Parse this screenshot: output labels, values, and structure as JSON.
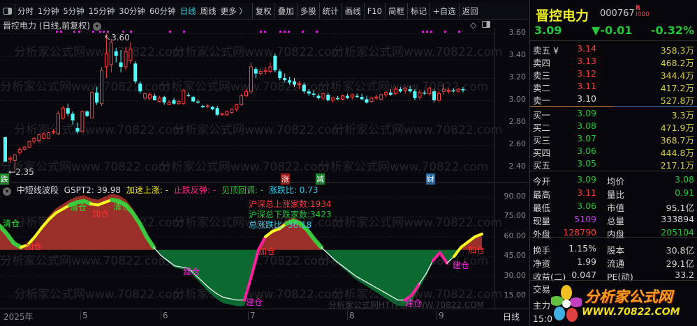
{
  "toolbar": {
    "items": [
      "分时",
      "1分钟",
      "5分钟",
      "15分钟",
      "30分钟",
      "60分钟",
      "日线",
      "周线",
      "更多 〉"
    ],
    "active": "日线",
    "right_items": [
      "复权",
      "叠加",
      "多股",
      "统计",
      "画线",
      "F10",
      "简框",
      "标记",
      "+自选",
      "返回"
    ]
  },
  "chart": {
    "title": "晋控电力 (日线,前复权)",
    "high_label": "3.60",
    "low_label": "2.35",
    "price_ticks": [
      "3.60",
      "3.40",
      "3.20",
      "3.00",
      "2.80",
      "2.60",
      "2.40"
    ],
    "signals": [
      {
        "text": "跌",
        "color": "#1a8a2a"
      },
      {
        "text": "涨",
        "color": "#a01818"
      },
      {
        "text": "减",
        "color": "#1a8a2a"
      },
      {
        "text": "财",
        "color": "#2a6aa0"
      }
    ]
  },
  "watermark": "分析家公式网www.70822.com",
  "watermark2": "分析家公式网HTTP://WWW.70822.COM",
  "indicator": {
    "name": "中短线波段",
    "gspt": "GSPT2: 39.98",
    "accel": "加速上涨: -",
    "rebound": "止跌反弹: -",
    "top": "见顶回调: -",
    "ratio": "涨跌比: 0.73",
    "up_count": "沪深总上涨家数:1934",
    "down_count": "沪深总下跌家数:3423",
    "total_ratio": "总涨跌比: 36.18",
    "ticks": [
      "90.00",
      "75.00",
      "60.00",
      "45.00",
      "30.00",
      "15.00"
    ],
    "labels": {
      "clear": "清仓",
      "add": "加仓",
      "build": "建仓"
    }
  },
  "xaxis": {
    "labels": [
      "2025年",
      "5",
      "6",
      "7",
      "8",
      "9"
    ],
    "period": "日线"
  },
  "colors": {
    "up": "#ff4040",
    "down": "#54ffff",
    "clear": "#3cc83c",
    "accel": "#ffff20",
    "rebound": "#ff20a0",
    "fall": "#ffffff",
    "area_up": "#9a2e28",
    "area_down": "#0a6a30"
  },
  "chart_data": [
    {
      "type": "candlestick",
      "name": "price",
      "ylim": [
        2.35,
        3.65
      ],
      "ohlc": [
        [
          2.67,
          2.67,
          2.45,
          2.45
        ],
        [
          2.47,
          2.5,
          2.44,
          2.48
        ],
        [
          2.46,
          2.52,
          2.35,
          2.51
        ],
        [
          2.53,
          2.58,
          2.51,
          2.56
        ],
        [
          2.56,
          2.59,
          2.55,
          2.58
        ],
        [
          2.58,
          2.64,
          2.57,
          2.63
        ],
        [
          2.63,
          2.67,
          2.61,
          2.66
        ],
        [
          2.64,
          2.7,
          2.62,
          2.69
        ],
        [
          2.66,
          2.71,
          2.65,
          2.7
        ],
        [
          2.66,
          2.72,
          2.66,
          2.71
        ],
        [
          2.72,
          2.74,
          2.7,
          2.72
        ],
        [
          2.7,
          2.9,
          2.69,
          2.88
        ],
        [
          2.84,
          2.95,
          2.83,
          2.93
        ],
        [
          2.93,
          2.97,
          2.86,
          2.88
        ],
        [
          2.88,
          2.9,
          2.78,
          2.82
        ],
        [
          2.75,
          2.8,
          2.7,
          2.72
        ],
        [
          2.72,
          2.91,
          2.71,
          2.9
        ],
        [
          2.9,
          2.91,
          2.85,
          2.86
        ],
        [
          2.84,
          3.08,
          2.84,
          3.07
        ],
        [
          3.07,
          3.12,
          2.96,
          2.98
        ],
        [
          2.97,
          3.3,
          2.95,
          3.27
        ],
        [
          3.3,
          3.6,
          3.2,
          3.42
        ],
        [
          3.32,
          3.55,
          3.25,
          3.52
        ],
        [
          3.44,
          3.47,
          3.34,
          3.4
        ],
        [
          3.34,
          3.45,
          3.25,
          3.3
        ],
        [
          3.3,
          3.48,
          3.27,
          3.44
        ],
        [
          3.36,
          3.52,
          3.33,
          3.46
        ],
        [
          3.33,
          3.35,
          3.15,
          3.17
        ],
        [
          3.15,
          3.17,
          3.06,
          3.08
        ],
        [
          3.02,
          3.07,
          3.0,
          3.06
        ],
        [
          3.02,
          3.07,
          3.0,
          3.05
        ],
        [
          3.04,
          3.06,
          3.0,
          3.0
        ],
        [
          2.99,
          3.04,
          2.98,
          3.02
        ],
        [
          3.03,
          3.04,
          2.96,
          2.98
        ],
        [
          2.96,
          3.0,
          2.96,
          2.98
        ],
        [
          3.0,
          3.02,
          2.96,
          2.97
        ],
        [
          2.97,
          3.0,
          2.96,
          2.99
        ],
        [
          2.97,
          3.1,
          2.96,
          3.09
        ],
        [
          3.05,
          3.07,
          3.03,
          3.04
        ],
        [
          3.03,
          3.04,
          2.98,
          2.99
        ],
        [
          2.99,
          3.01,
          2.97,
          2.98
        ],
        [
          2.95,
          2.96,
          2.93,
          2.94
        ],
        [
          2.95,
          2.97,
          2.93,
          2.95
        ],
        [
          2.94,
          2.95,
          2.91,
          2.92
        ],
        [
          2.93,
          2.95,
          2.86,
          2.87
        ],
        [
          2.87,
          2.89,
          2.86,
          2.88
        ],
        [
          2.87,
          2.91,
          2.86,
          2.9
        ],
        [
          2.89,
          2.93,
          2.88,
          2.92
        ],
        [
          2.92,
          2.97,
          2.9,
          2.96
        ],
        [
          2.96,
          3.06,
          2.95,
          3.04
        ],
        [
          3.04,
          3.1,
          3.03,
          3.08
        ],
        [
          3.08,
          3.34,
          3.06,
          3.3
        ],
        [
          3.28,
          3.3,
          3.2,
          3.24
        ],
        [
          3.24,
          3.28,
          3.22,
          3.26
        ],
        [
          3.26,
          3.3,
          3.23,
          3.27
        ],
        [
          3.26,
          3.34,
          3.24,
          3.3
        ],
        [
          3.4,
          3.42,
          3.25,
          3.27
        ],
        [
          3.26,
          3.28,
          3.18,
          3.2
        ],
        [
          3.2,
          3.24,
          3.16,
          3.18
        ],
        [
          3.18,
          3.21,
          3.14,
          3.16
        ],
        [
          3.17,
          3.2,
          3.12,
          3.14
        ],
        [
          3.14,
          3.17,
          3.1,
          3.15
        ],
        [
          3.14,
          3.16,
          3.06,
          3.08
        ],
        [
          3.08,
          3.1,
          3.04,
          3.06
        ],
        [
          3.06,
          3.09,
          3.03,
          3.05
        ],
        [
          3.04,
          3.06,
          3.01,
          3.02
        ],
        [
          3.02,
          3.07,
          3.0,
          3.06
        ],
        [
          3.05,
          3.07,
          2.99,
          3.0
        ],
        [
          3.0,
          3.03,
          2.98,
          3.02
        ],
        [
          3.02,
          3.04,
          3.0,
          3.01
        ],
        [
          3.01,
          3.05,
          3.0,
          3.04
        ],
        [
          3.04,
          3.06,
          3.01,
          3.02
        ],
        [
          3.03,
          3.06,
          3.01,
          3.05
        ],
        [
          3.04,
          3.06,
          3.02,
          3.03
        ],
        [
          3.03,
          3.06,
          3.0,
          3.01
        ],
        [
          3.01,
          3.04,
          2.97,
          2.98
        ],
        [
          2.99,
          3.03,
          2.98,
          3.02
        ],
        [
          3.02,
          3.05,
          3.0,
          3.03
        ],
        [
          3.01,
          3.06,
          3.0,
          3.05
        ],
        [
          3.05,
          3.08,
          3.03,
          3.07
        ],
        [
          3.07,
          3.1,
          3.04,
          3.05
        ],
        [
          3.06,
          3.12,
          3.05,
          3.1
        ],
        [
          3.1,
          3.12,
          3.07,
          3.08
        ],
        [
          3.09,
          3.12,
          3.06,
          3.11
        ],
        [
          3.1,
          3.13,
          3.07,
          3.08
        ],
        [
          3.08,
          3.1,
          3.0,
          3.02
        ],
        [
          3.03,
          3.09,
          3.01,
          3.07
        ],
        [
          3.07,
          3.09,
          3.05,
          3.06
        ],
        [
          3.06,
          3.12,
          3.04,
          3.11
        ],
        [
          3.08,
          3.1,
          2.98,
          3.0
        ],
        [
          3.0,
          3.08,
          2.99,
          3.06
        ],
        [
          3.08,
          3.15,
          3.05,
          3.1
        ],
        [
          3.08,
          3.11,
          3.06,
          3.09
        ],
        [
          3.09,
          3.11,
          3.07,
          3.08
        ],
        [
          3.08,
          3.11,
          3.07,
          3.1
        ],
        [
          3.1,
          3.12,
          3.07,
          3.09
        ]
      ]
    },
    {
      "type": "line",
      "name": "GSPT2",
      "ylim": [
        0,
        95
      ],
      "baseline": 50,
      "values": [
        68,
        62,
        55,
        52,
        54,
        60,
        67,
        73,
        78,
        81,
        84,
        86,
        87,
        85,
        84,
        86,
        88,
        87,
        84,
        78,
        70,
        60,
        52,
        46,
        42,
        38,
        37,
        36,
        31,
        26,
        21,
        17,
        14,
        13,
        12,
        12,
        30,
        50,
        60,
        64,
        66,
        70,
        72,
        70,
        65,
        58,
        52,
        47,
        42,
        38,
        34,
        30,
        27,
        24,
        21,
        18,
        15,
        12,
        12,
        16,
        24,
        32,
        42,
        48,
        40,
        45,
        52,
        56,
        60,
        62
      ],
      "states": [
        "clear",
        "clear",
        "clear",
        "accel",
        "accel",
        "accel",
        "accel",
        "accel",
        "accel",
        "accel",
        "clear",
        "clear",
        "clear",
        "accel",
        "accel",
        "accel",
        "clear",
        "clear",
        "clear",
        "clear",
        "clear",
        "clear",
        "fall",
        "fall",
        "fall",
        "fall",
        "fall",
        "fall",
        "fall",
        "fall",
        "fall",
        "fall",
        "fall",
        "fall",
        "fall",
        "rebound",
        "rebound",
        "rebound",
        "accel",
        "accel",
        "accel",
        "clear",
        "clear",
        "clear",
        "clear",
        "clear",
        "fall",
        "fall",
        "fall",
        "fall",
        "fall",
        "fall",
        "fall",
        "fall",
        "fall",
        "fall",
        "fall",
        "fall",
        "rebound",
        "rebound",
        "fall",
        "fall",
        "rebound",
        "rebound",
        "fall",
        "accel",
        "accel",
        "accel",
        "accel",
        "accel"
      ]
    }
  ],
  "quote": {
    "name": "晋控电力",
    "code": "000767",
    "badge_top": "R",
    "badge_bottom": "I000",
    "price": "3.09",
    "change": "▼-0.01",
    "pct": "-0.32%"
  },
  "orderbook": {
    "asks": [
      {
        "label": "卖五 ¥",
        "price": "3.14",
        "vol": "358.3万"
      },
      {
        "label": "卖四",
        "price": "3.13",
        "vol": "468.2万"
      },
      {
        "label": "卖三",
        "price": "3.12",
        "vol": "344.4万"
      },
      {
        "label": "卖二",
        "price": "3.11",
        "vol": "417.2万"
      },
      {
        "label": "卖一",
        "price": "3.10",
        "vol": "527.8万"
      }
    ],
    "bids": [
      {
        "label": "买一",
        "price": "3.09",
        "vol": "3.3万"
      },
      {
        "label": "买二",
        "price": "3.08",
        "vol": "471.9万"
      },
      {
        "label": "买三",
        "price": "3.07",
        "vol": "368.7万"
      },
      {
        "label": "买四",
        "price": "3.06",
        "vol": "444.8万"
      },
      {
        "label": "买五",
        "price": "3.05",
        "vol": "217.1万"
      }
    ]
  },
  "stats": [
    {
      "l1": "今开",
      "v1": "3.09",
      "c1": "green",
      "l2": "均价",
      "v2": "3.08",
      "c2": "green"
    },
    {
      "l1": "最高",
      "v1": "3.11",
      "c1": "red",
      "l2": "量比",
      "v2": "0.91",
      "c2": "green"
    },
    {
      "l1": "最低",
      "v1": "3.06",
      "c1": "green",
      "l2": "市值",
      "v2": "95.1亿",
      "c2": "white"
    },
    {
      "l1": "现量",
      "v1": "5109",
      "c1": "mag",
      "l2": "总量",
      "v2": "333894",
      "c2": "white"
    },
    {
      "l1": "外盘",
      "v1": "128790",
      "c1": "red",
      "l2": "内盘",
      "v2": "205104",
      "c2": "green"
    },
    {
      "l1": "换手",
      "v1": "1.15%",
      "c1": "white",
      "l2": "股本",
      "v2": "30.8亿",
      "c2": "white"
    },
    {
      "l1": "净资",
      "v1": "1.99",
      "c1": "white",
      "l2": "流通",
      "v2": "29.1亿",
      "c2": "white"
    },
    {
      "l1": "收益(二)",
      "v1": "0.047",
      "c1": "white",
      "l2": "PE(动)",
      "v2": "33.2",
      "c2": "white"
    }
  ],
  "bottom_rows": [
    "交易",
    "主力",
    "15:0"
  ],
  "logo": {
    "title": "分析家公式网",
    "url": "WWW.70822.COM"
  }
}
